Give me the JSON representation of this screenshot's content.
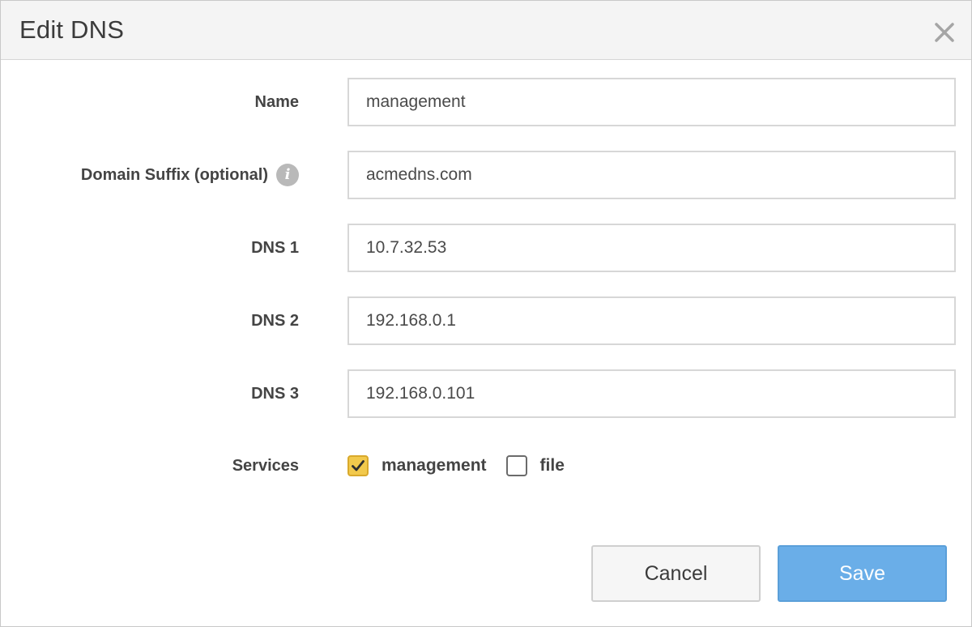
{
  "dialog": {
    "title": "Edit DNS",
    "close_icon": "close-icon"
  },
  "form": {
    "name": {
      "label": "Name",
      "value": "management"
    },
    "domain_suffix": {
      "label": "Domain Suffix (optional)",
      "value": "acmedns.com",
      "info_icon": "i"
    },
    "dns1": {
      "label": "DNS 1",
      "value": "10.7.32.53"
    },
    "dns2": {
      "label": "DNS 2",
      "value": "192.168.0.1"
    },
    "dns3": {
      "label": "DNS 3",
      "value": "192.168.0.101"
    },
    "services": {
      "label": "Services",
      "options": [
        {
          "label": "management",
          "checked": true
        },
        {
          "label": "file",
          "checked": false
        }
      ]
    }
  },
  "buttons": {
    "cancel": "Cancel",
    "save": "Save"
  },
  "colors": {
    "header_bg": "#f4f4f4",
    "checkbox_checked": "#f2c94c",
    "save_button": "#6aaee8"
  }
}
